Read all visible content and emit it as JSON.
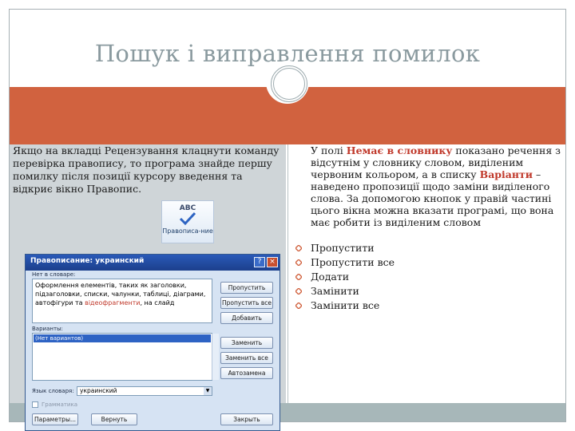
{
  "slide": {
    "title": "Пошук і виправлення помилок",
    "left_text": "Якщо на  вкладці Рецензування клацнути команду перевірка правопису, то програма знайде першу помилку після позиції курсору  введення та відкриє вікно Правопис.",
    "right_intro_before": "У полі ",
    "right_intro_hl1": "Немає в словнику",
    "right_intro_mid": " показано речення з відсутнім у словнику словом, виділеним червоним кольором, а в списку ",
    "right_intro_hl2": "Варіанти",
    "right_intro_after": " – наведено пропозиції щодо заміни виділеного слова. За допомогою кнопок  у правій частині цього вікна можна вказати програмі, що вона має робити із виділеним словом",
    "bullets": [
      "Пропустити",
      "Пропустити все",
      "Додати",
      "Замінити",
      "Замінити все"
    ],
    "colors": {
      "accent_band": "#d1623f",
      "left_panel": "#cfd5d8",
      "bottom_band": "#a7b7b9",
      "highlight": "#c0392b",
      "bullet": "#d1623f"
    }
  },
  "ribbon_button": {
    "icon": "spelling-check-icon",
    "abc": "ABC",
    "label": "Правописа-ние"
  },
  "dialog": {
    "title": "Правописание: украинский",
    "help_glyph": "?",
    "close_glyph": "×",
    "not_in_dict_label": "Нет в словаре:",
    "sentence_lines_before": "Оформлення елементів, таких як заголовки, підзаголовки, списки, чалунки, таблиці, діаграми, автофігури та ",
    "sentence_error_word": "відеофрагменти",
    "sentence_after": ", на слайд",
    "suggestions_label": "Варианты:",
    "suggestion_item": "(Нет вариантов)",
    "dict_lang_label": "Язык словаря:",
    "dict_lang_value": "украинский",
    "grammar_label": "Грамматика",
    "buttons": {
      "skip": "Пропустить",
      "skip_all": "Пропустить все",
      "add": "Добавить",
      "change": "Заменить",
      "change_all": "Заменить все",
      "autocorrect": "Автозамена",
      "options": "Параметры...",
      "undo": "Вернуть",
      "cancel": "Закрыть"
    }
  }
}
